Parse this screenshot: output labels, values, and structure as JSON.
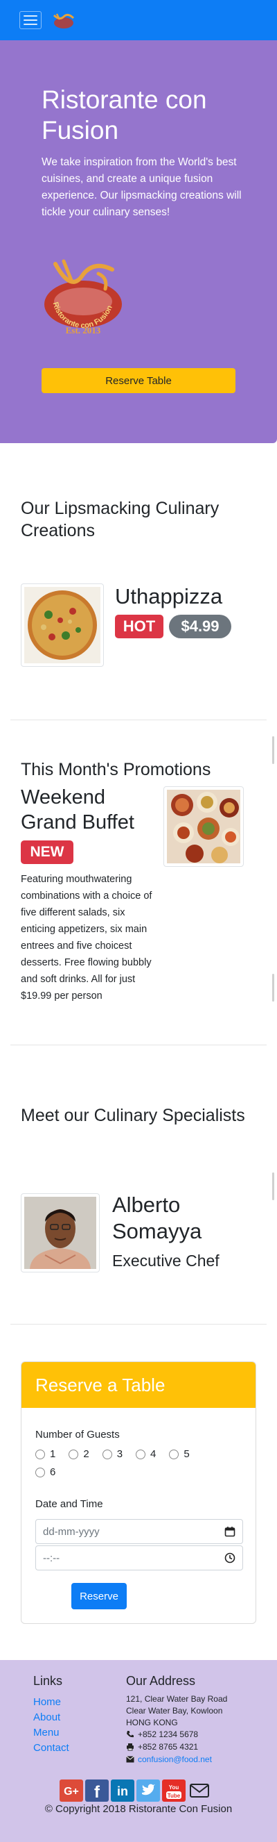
{
  "jumbotron": {
    "title": "Ristorante con Fusion",
    "description": "We take inspiration from the World's best cuisines, and create a unique fusion experience. Our lipsmacking creations will tickle your culinary senses!",
    "logo_text": "Ristorante con Fusion",
    "logo_est": "Est. 2013",
    "reserve_button": "Reserve Table"
  },
  "dishes": {
    "title": "Our Lipsmacking Culinary Creations",
    "name": "Uthappizza",
    "label": "HOT",
    "price": "$4.99"
  },
  "promotions": {
    "title": "This Month's Promotions",
    "name": "Weekend Grand Buffet",
    "label": "NEW",
    "description": "Featuring mouthwatering combinations with a choice of five different salads, six enticing appetizers, six main entrees and five choicest desserts. Free flowing bubbly and soft drinks. All for just $19.99 per person"
  },
  "leaders": {
    "title": "Meet our Culinary Specialists",
    "name": "Alberto Somayya",
    "designation": "Executive Chef"
  },
  "reserve": {
    "title": "Reserve a Table",
    "guests_label": "Number of Guests",
    "guest_options": [
      "1",
      "2",
      "3",
      "4",
      "5",
      "6"
    ],
    "datetime_label": "Date and Time",
    "date_placeholder": "dd-mm-yyyy",
    "time_placeholder": "--:--",
    "submit": "Reserve"
  },
  "footer": {
    "links_heading": "Links",
    "links": [
      "Home",
      "About",
      "Menu",
      "Contact"
    ],
    "address_heading": "Our Address",
    "address_lines": [
      "121, Clear Water Bay Road",
      "Clear Water Bay, Kowloon",
      "HONG KONG"
    ],
    "phone": "+852 1234 5678",
    "fax": "+852 8765 4321",
    "email": "confusion@food.net",
    "social_icons": [
      "google-plus-icon",
      "facebook-icon",
      "linkedin-icon",
      "twitter-icon",
      "youtube-icon",
      "mail-icon"
    ],
    "copyright": "© Copyright 2018 Ristorante Con Fusion"
  },
  "colors": {
    "navbar": "#0d7df5",
    "jumbotron": "#9575cd",
    "accent": "#ffc107",
    "footer": "#d1c4e9",
    "badge_hot": "#dc3545",
    "badge_price": "#6c757d"
  }
}
